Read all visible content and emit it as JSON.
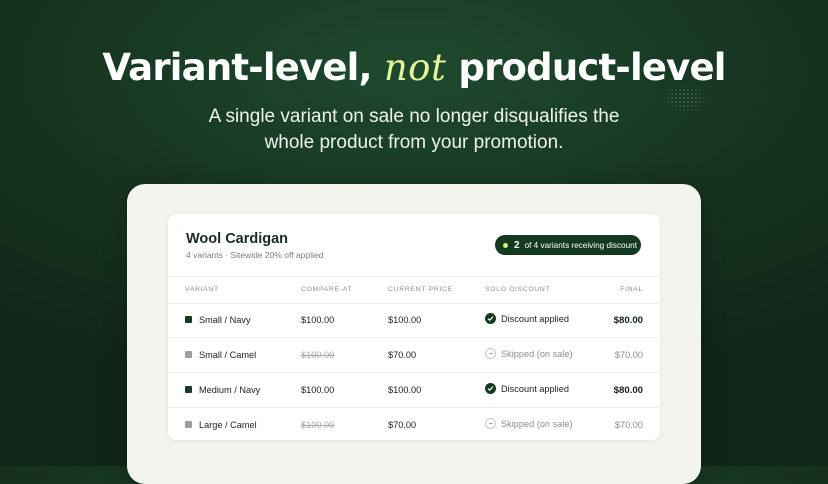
{
  "hero": {
    "title_part1": "Variant-level, ",
    "title_accent": "not",
    "title_part2": " product-level",
    "subtitle_line1": "A single variant on sale no longer disqualifies the",
    "subtitle_line2": "whole product from your promotion."
  },
  "card": {
    "title": "Wool Cardigan",
    "subtitle": "4 variants · Sitewide 20% off applied",
    "badge_count": "2",
    "badge_text": "of 4 variants receiving discount",
    "columns": [
      "VARIANT",
      "COMPARE-AT",
      "CURRENT PRICE",
      "SOLO DISCOUNT",
      "FINAL"
    ],
    "rows": [
      {
        "variant": "Small / Navy",
        "compare_at": "$100.00",
        "current": "$100.00",
        "status": "Discount applied",
        "final": "$80.00",
        "applied": true
      },
      {
        "variant": "Small / Camel",
        "compare_at": "$100.00",
        "current": "$70.00",
        "status": "Skipped (on sale)",
        "final": "$70.00",
        "applied": false
      },
      {
        "variant": "Medium / Navy",
        "compare_at": "$100.00",
        "current": "$100.00",
        "status": "Discount applied",
        "final": "$80.00",
        "applied": true
      },
      {
        "variant": "Large / Camel",
        "compare_at": "$100.00",
        "current": "$70.00",
        "status": "Skipped (on sale)",
        "final": "$70.00",
        "applied": false
      }
    ]
  },
  "icons": {
    "applied": "check-circle-icon",
    "skipped": "minus-circle-icon"
  },
  "colors": {
    "brand": "#133a20",
    "accent": "#e6f59a"
  }
}
